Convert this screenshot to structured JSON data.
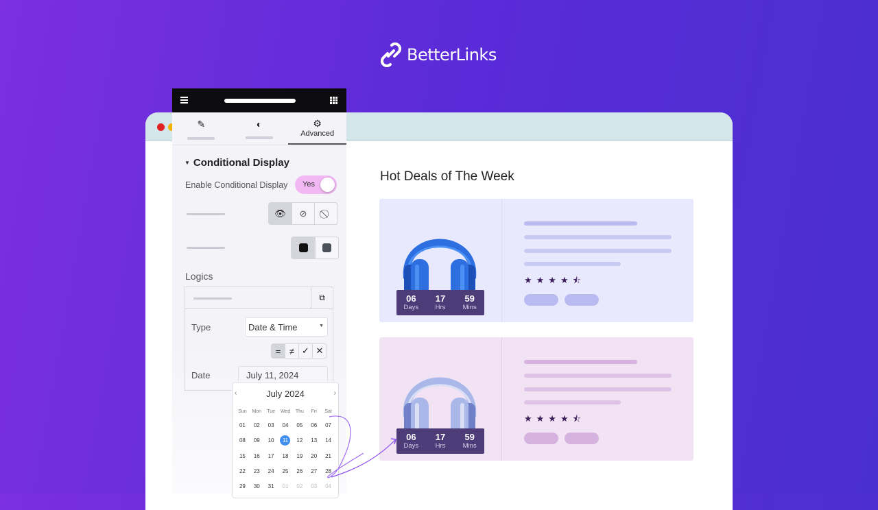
{
  "brand": {
    "name": "BetterLinks",
    "icon": "link-icon"
  },
  "browser": {
    "dots": [
      "#e02020",
      "#f0b400"
    ]
  },
  "panel": {
    "tabs": [
      {
        "icon": "pencil-icon",
        "label": ""
      },
      {
        "icon": "contrast-icon",
        "label": ""
      },
      {
        "icon": "gear-icon",
        "label": "Advanced",
        "active": true
      }
    ],
    "section_title": "Conditional Display",
    "enable_label": "Enable Conditional Display",
    "toggle": {
      "label": "Yes",
      "on": true,
      "color": "#f1b8f3"
    },
    "logics_label": "Logics",
    "type_label": "Type",
    "type_value": "Date & Time",
    "operators": [
      "=",
      "≠",
      "✓",
      "✕"
    ],
    "date_label": "Date",
    "date_value": "July 11, 2024"
  },
  "calendar": {
    "title": "July 2024",
    "weekdays": [
      "Sun",
      "Mon",
      "Tue",
      "Wed",
      "Thu",
      "Fri",
      "Sat"
    ],
    "days": [
      "01",
      "02",
      "03",
      "04",
      "05",
      "06",
      "07",
      "08",
      "09",
      "10",
      "11",
      "12",
      "13",
      "14",
      "15",
      "16",
      "17",
      "18",
      "19",
      "20",
      "21",
      "22",
      "23",
      "24",
      "25",
      "26",
      "27",
      "28",
      "29",
      "30",
      "31"
    ],
    "next_days": [
      "01",
      "02",
      "03",
      "04"
    ],
    "selected": "11",
    "selected_color": "#3f8ef0"
  },
  "main": {
    "title": "Hot Deals of The Week",
    "deals": [
      {
        "countdown": [
          {
            "value": "06",
            "unit": "Days"
          },
          {
            "value": "17",
            "unit": "Hrs"
          },
          {
            "value": "59",
            "unit": "Mins"
          }
        ],
        "rating": 4.5,
        "bg": "#e9e9fd",
        "accent": "#b9baf0"
      },
      {
        "countdown": [
          {
            "value": "06",
            "unit": "Days"
          },
          {
            "value": "17",
            "unit": "Hrs"
          },
          {
            "value": "59",
            "unit": "Mins"
          }
        ],
        "rating": 4.5,
        "bg": "#f1e3f3",
        "accent": "#d6b2e0"
      }
    ]
  }
}
